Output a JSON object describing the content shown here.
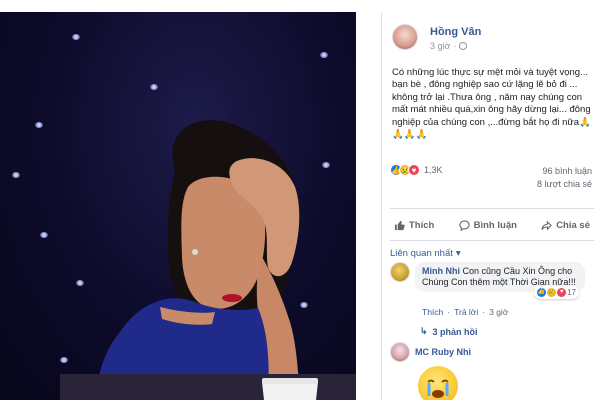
{
  "post": {
    "author": "Hồng Vân",
    "time": "3 giờ",
    "text": "Có những lúc thực sự mệt mỏi và tuyệt vọng... bạn bè , đông nghiệp sao cứ lặng lẽ bỏ đi ... không trở lại .Thưa ông , năm nay chúng con mất mát nhiều quá,xin ông hãy dừng lại... đông nghiệp của chúng con ,...đừng bắt họ đi nữa🙏🙏🙏🙏",
    "reaction_count": "1,3K",
    "comments_count": "96 bình luận",
    "shares_count": "8 lượt chia sẻ"
  },
  "actions": {
    "like": "Thích",
    "comment": "Bình luận",
    "share": "Chia sẻ"
  },
  "related_label": "Liên quan nhất",
  "comments": [
    {
      "name": "Minh Nhi",
      "text": "Con cũng Cầu Xin Ông cho Chúng Con thêm một Thời Gian nữa!!!",
      "reaction_count": "17",
      "like_label": "Thích",
      "reply_label": "Trả lời",
      "time": "3 giờ",
      "replies_label": "3 phản hồi"
    },
    {
      "name": "MC Ruby Nhi"
    }
  ],
  "icons": {
    "like": "thumbs-up-icon",
    "comment": "speech-bubble-icon",
    "share": "share-arrow-icon",
    "privacy": "globe-icon",
    "sticker": "crying-face-sticker"
  },
  "colors": {
    "link": "#385898",
    "like_reaction": "#1877f2",
    "love_reaction": "#e9445a",
    "sad_reaction": "#f7b125",
    "muted_text": "#606770"
  }
}
